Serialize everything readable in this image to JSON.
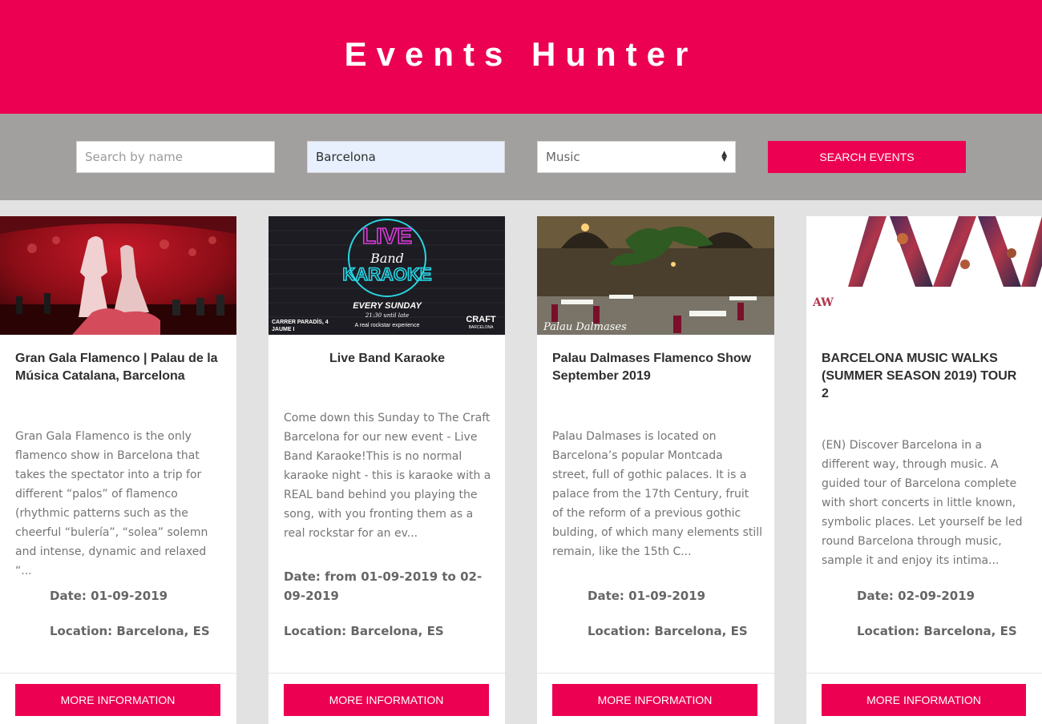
{
  "header": {
    "title": "Events Hunter"
  },
  "search": {
    "name_placeholder": "Search by name",
    "city_value": "Barcelona",
    "category_value": "Music",
    "button_label": "SEARCH EVENTS"
  },
  "colors": {
    "accent": "#ec0052",
    "search_bar": "#a29f9f",
    "background": "#e2e2e2"
  },
  "events": [
    {
      "title": "Gran Gala Flamenco | Palau de la Música Catalana, Barcelona",
      "description": "Gran Gala Flamenco is the only flamenco show in Barcelona that takes the spectator into a trip for different “palos” of flamenco (rhythmic patterns such as the cheerful  “bulería”, “solea” solemn and intense, dynamic and relaxed “...",
      "date": "Date: 01-09-2019",
      "location": "Location: Barcelona, ES",
      "button_label": "MORE INFORMATION"
    },
    {
      "title": "Live Band Karaoke",
      "description": "Come down this Sunday to The Craft Barcelona for our new event - Live Band Karaoke!This is no normal karaoke night - this is karaoke with a REAL band behind you playing the song, with you fronting them as a real rockstar for an ev...",
      "date": "Date: from 01-09-2019 to 02-09-2019",
      "location": "Location: Barcelona, ES",
      "button_label": "MORE INFORMATION",
      "image_text": {
        "line1": "LIVE",
        "line2": "Band",
        "line3": "KARAOKE",
        "sunday": "EVERY SUNDAY",
        "time": "21:30 until late",
        "tagline": "A real rockstar experience",
        "address1": "CARRER PARADÍS, 4",
        "address2": "JAUME I",
        "brand": "CRAFT",
        "brand_sub": "BARCELONA"
      }
    },
    {
      "title": "Palau Dalmases Flamenco Show September 2019",
      "description": "Palau Dalmases is located on Barcelona’s popular Montcada street, full of gothic palaces. It is a palace from the 17th Century, fruit of the reform of a previous gothic bulding, of which many elements still remain, like the 15th C...",
      "date": "Date: 01-09-2019",
      "location": "Location: Barcelona, ES",
      "button_label": "MORE INFORMATION",
      "image_text": {
        "signature": "Palau Dalmases"
      }
    },
    {
      "title": "BARCELONA MUSIC WALKS (SUMMER SEASON 2019) TOUR 2",
      "description": "(EN) Discover Barcelona in a different way, through music. A guided tour of Barcelona complete with short concerts in little known, symbolic places. Let yourself be led round Barcelona through music, sample it and enjoy its intima...",
      "date": "Date: 02-09-2019",
      "location": "Location: Barcelona, ES",
      "button_label": "MORE INFORMATION",
      "image_text": {
        "logo": "AW"
      }
    }
  ]
}
